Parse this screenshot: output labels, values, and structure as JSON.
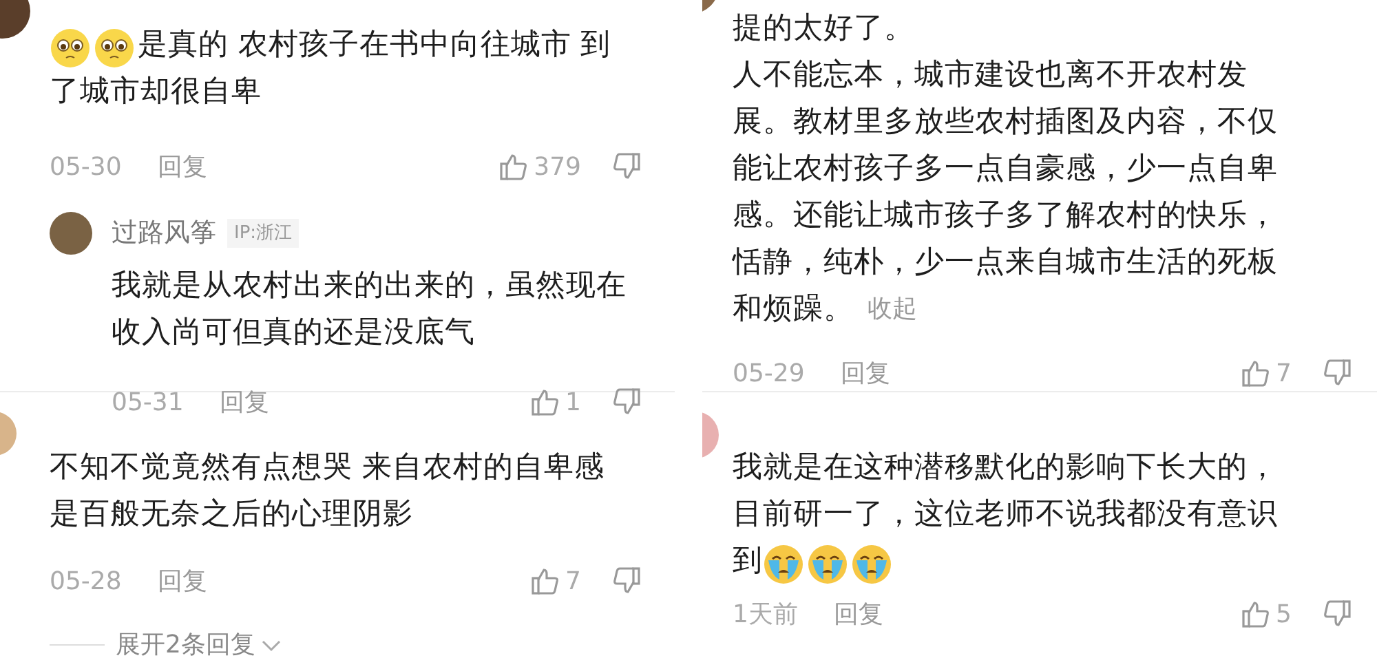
{
  "panels": [
    {
      "top": {
        "lines": [
          [
            {
              "kind": "pleading-emoji"
            },
            {
              "kind": "pleading-emoji"
            },
            {
              "kind": "text",
              "text": "是真的 农村孩子在书中向往城市 到"
            }
          ],
          [
            {
              "kind": "text",
              "text": "了城市却很自卑"
            }
          ]
        ],
        "date": "05-30",
        "reply": "回复",
        "likes": "379",
        "replies": [
          {
            "name": "过路风筝",
            "ip": "IP:浙江",
            "lines": [
              [
                {
                  "kind": "text",
                  "text": "我就是从农村出来的出来的，虽然现在"
                }
              ],
              [
                {
                  "kind": "text",
                  "text": "收入尚可但真的还是没底气"
                }
              ]
            ],
            "date": "05-31",
            "reply": "回复",
            "likes": "1"
          }
        ]
      },
      "bottom": {
        "lines": [
          [
            {
              "kind": "text",
              "text": "不知不觉竟然有点想哭 来自农村的自卑感"
            }
          ],
          [
            {
              "kind": "text",
              "text": "是百般无奈之后的心理阴影"
            }
          ]
        ],
        "date": "05-28",
        "reply": "回复",
        "likes": "7",
        "expand": "展开2条回复"
      }
    },
    {
      "top": {
        "lines": [
          [
            {
              "kind": "text",
              "text": "提的太好了。"
            }
          ],
          [
            {
              "kind": "text",
              "text": "人不能忘本，城市建设也离不开农村发"
            }
          ],
          [
            {
              "kind": "text",
              "text": "展。教材里多放些农村插图及内容，不仅"
            }
          ],
          [
            {
              "kind": "text",
              "text": "能让农村孩子多一点自豪感，少一点自卑"
            }
          ],
          [
            {
              "kind": "text",
              "text": "感。还能让城市孩子多了解农村的快乐，"
            }
          ],
          [
            {
              "kind": "text",
              "text": "恬静，纯朴，少一点来自城市生活的死板"
            }
          ],
          [
            {
              "kind": "text",
              "text": "和烦躁。"
            },
            {
              "kind": "collapse-link",
              "text": "收起"
            }
          ]
        ],
        "date": "05-29",
        "reply": "回复",
        "likes": "7"
      },
      "bottom": {
        "lines": [
          [
            {
              "kind": "text",
              "text": "我就是在这种潜移默化的影响下长大的，"
            }
          ],
          [
            {
              "kind": "text",
              "text": "目前研一了，这位老师不说我都没有意识"
            }
          ],
          [
            {
              "kind": "text",
              "text": "到"
            },
            {
              "kind": "crying-emoji"
            },
            {
              "kind": "crying-emoji"
            },
            {
              "kind": "crying-emoji"
            }
          ]
        ],
        "date": "1天前",
        "reply": "回复",
        "likes": "5"
      }
    }
  ]
}
